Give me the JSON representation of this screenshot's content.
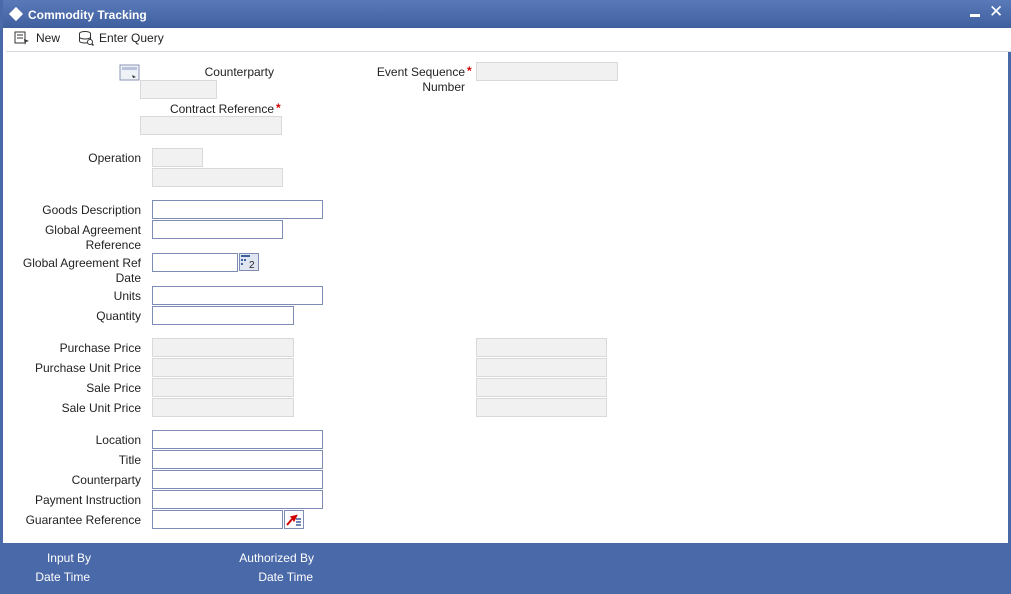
{
  "window": {
    "title": "Commodity Tracking"
  },
  "toolbar": {
    "new_label": "New",
    "enter_query_label": "Enter Query"
  },
  "header": {
    "counterparty_label": "Counterparty",
    "event_sequence_label_line1": "Event Sequence",
    "event_sequence_label_line2": "Number",
    "contract_reference_label": "Contract Reference",
    "required_mark": "*"
  },
  "fields": {
    "operation_label": "Operation",
    "goods_description_label": "Goods Description",
    "global_agreement_ref_line1": "Global Agreement",
    "global_agreement_ref_line2": "Reference",
    "global_agreement_date_line1": "Global Agreement Ref",
    "global_agreement_date_line2": "Date",
    "units_label": "Units",
    "quantity_label": "Quantity",
    "purchase_price_label": "Purchase Price",
    "purchase_unit_price_label": "Purchase Unit Price",
    "sale_price_label": "Sale Price",
    "sale_unit_price_label": "Sale Unit Price",
    "location_label": "Location",
    "title_label": "Title",
    "counterparty_label": "Counterparty",
    "payment_instruction_label": "Payment Instruction",
    "guarantee_reference_label": "Guarantee Reference"
  },
  "footer": {
    "input_by_label": "Input By",
    "date_time_label_1": "Date Time",
    "authorized_by_label": "Authorized By",
    "date_time_label_2": "Date Time"
  },
  "icons": {
    "lookup": "lookup-icon",
    "calendar": "calendar-icon",
    "guarantee_lov": "list-of-values-icon"
  },
  "colors": {
    "titlebar": "#4a69a8",
    "footer": "#4a69a8",
    "required": "#d00000",
    "input_border": "#7e8cb3",
    "readonly_bg": "#f1f1f1"
  }
}
